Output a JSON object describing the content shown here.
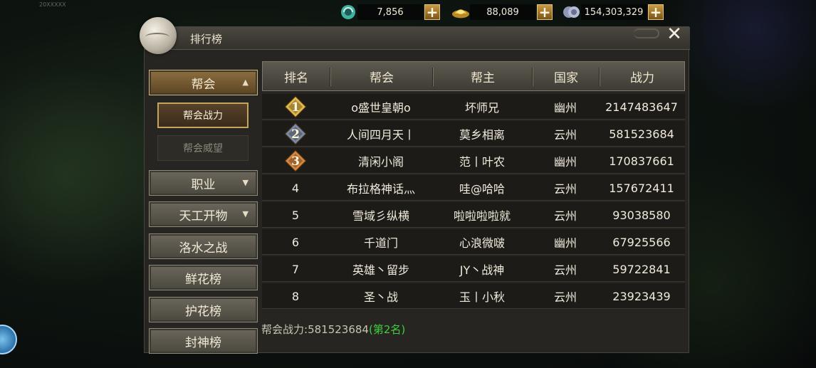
{
  "top_left_text": "20XXXXX",
  "currency": [
    {
      "icon": "jade-coin-icon",
      "value": "7,856"
    },
    {
      "icon": "gold-ingot-icon",
      "value": "88,089"
    },
    {
      "icon": "silver-coin-icon",
      "value": "154,303,329"
    }
  ],
  "currency_plus": "+",
  "window": {
    "title": "排行榜",
    "close": "✕"
  },
  "sidebar": {
    "top": {
      "label": "帮会",
      "arrow": "▲"
    },
    "sub": [
      {
        "label": "帮会战力"
      },
      {
        "label": "帮会威望"
      }
    ],
    "items": [
      {
        "label": "职业",
        "arrow": "▼"
      },
      {
        "label": "天工开物",
        "arrow": "▼"
      },
      {
        "label": "洛水之战"
      },
      {
        "label": "鲜花榜"
      },
      {
        "label": "护花榜"
      },
      {
        "label": "封神榜"
      }
    ]
  },
  "table": {
    "headers": [
      "排名",
      "帮会",
      "帮主",
      "国家",
      "战力"
    ],
    "rows": [
      {
        "rank": "1",
        "guild": "o盛世皇朝o",
        "leader": "坏师兄",
        "country": "幽州",
        "power": "2147483647"
      },
      {
        "rank": "2",
        "guild": "人间四月天丨",
        "leader": "莫乡相离",
        "country": "云州",
        "power": "581523684"
      },
      {
        "rank": "3",
        "guild": "清闲小阁",
        "leader": "范丨叶农",
        "country": "幽州",
        "power": "170837661"
      },
      {
        "rank": "4",
        "guild": "布拉格神话灬",
        "leader": "哇@哈哈",
        "country": "云州",
        "power": "157672411"
      },
      {
        "rank": "5",
        "guild": "雪域彡纵横",
        "leader": "啦啦啦啦就",
        "country": "云州",
        "power": "93038580"
      },
      {
        "rank": "6",
        "guild": "千道门",
        "leader": "心浪微啵",
        "country": "幽州",
        "power": "67925566"
      },
      {
        "rank": "7",
        "guild": "英雄丶留步",
        "leader": "JY丶战神",
        "country": "云州",
        "power": "59722841"
      },
      {
        "rank": "8",
        "guild": "圣丶战",
        "leader": "玉丨小秋",
        "country": "云州",
        "power": "23923439"
      }
    ]
  },
  "footer": {
    "label": "帮会战力:",
    "value": "581523684",
    "rank": "(第2名)"
  },
  "colors": {
    "gold": "#d4b474",
    "rank_green": "#3fcf3a",
    "medal1": "#e2b84a",
    "medal2": "#7c8aa8",
    "medal3": "#d7853c"
  }
}
